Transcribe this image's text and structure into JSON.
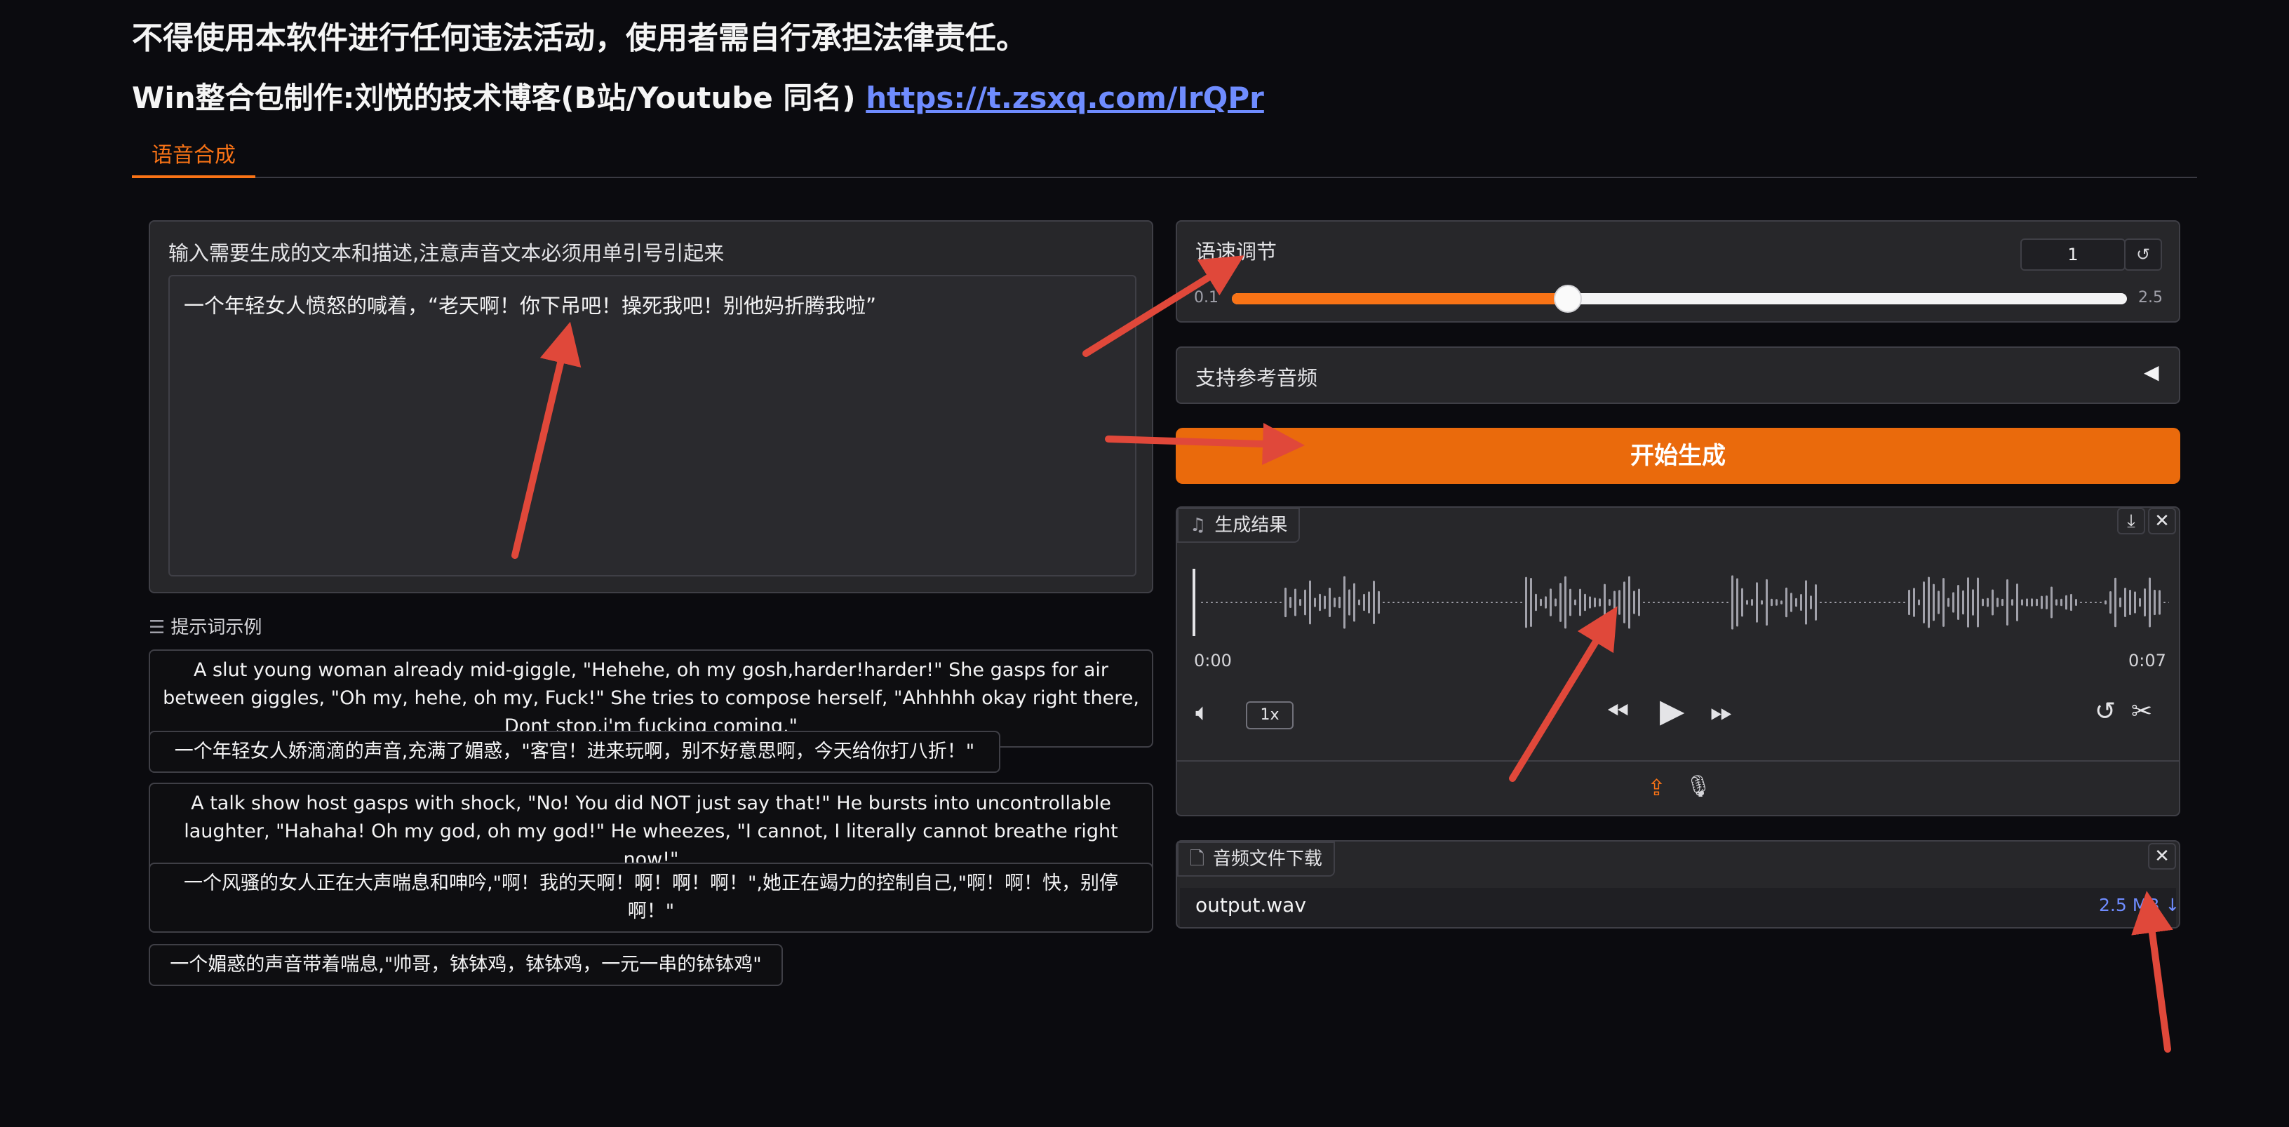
{
  "header": {
    "warning": "不得使用本软件进行任何违法活动，使用者需自行承担法律责任。",
    "credit_prefix": "Win整合包制作:刘悦的技术博客(B站/Youtube 同名) ",
    "credit_link": "https://t.zsxq.com/IrQPr"
  },
  "tabs": [
    {
      "label": "语音合成",
      "active": true
    }
  ],
  "text_input": {
    "label": "输入需要生成的文本和描述,注意声音文本必须用单引号引起来",
    "value": "一个年轻女人愤怒的喊着，“老天啊！你下吊吧！操死我吧！别他妈折腾我啦”"
  },
  "examples": {
    "header": "提示词示例",
    "items": [
      "A slut young woman already mid-giggle, \"Hehehe, oh my gosh,harder!harder!\" She gasps for air between giggles, \"Oh my, hehe, oh my, Fuck!\" She tries to compose herself, \"Ahhhhh okay right there, Dont stop,i'm fucking coming.\"",
      "一个年轻女人娇滴滴的声音,充满了媚惑，\"客官！进来玩啊，别不好意思啊，今天给你打八折！\"",
      "A talk show host gasps with shock, \"No! You did NOT just say that!\" He bursts into uncontrollable laughter, \"Hahaha! Oh my god, oh my god!\" He wheezes, \"I cannot, I literally cannot breathe right now!\"",
      "一个风骚的女人正在大声喘息和呻吟,\"啊！我的天啊！啊！啊！啊！\",她正在竭力的控制自己,\"啊！啊！快，别停啊！\"",
      "一个媚惑的声音带着喘息,\"帅哥，钵钵鸡，钵钵鸡，一元一串的钵钵鸡\""
    ]
  },
  "speed": {
    "label": "语速调节",
    "value": "1",
    "min_label": "0.1",
    "max_label": "2.5",
    "min": 0.1,
    "max": 2.5,
    "current": 1
  },
  "reference_audio": {
    "label": "支持参考音频",
    "toggle_icon": "triangle-left-icon"
  },
  "generate_button": "开始生成",
  "audio_output": {
    "label": "生成结果",
    "time_start": "0:00",
    "time_end": "0:07",
    "playback_rate": "1x"
  },
  "file_output": {
    "label": "音频文件下载",
    "file_name": "output.wav",
    "file_size": "2.5 MB ↓"
  },
  "colors": {
    "accent": "#f97316",
    "button": "#ea6a0c",
    "link": "#6f8cff",
    "annotation_arrow": "#e0483a"
  }
}
